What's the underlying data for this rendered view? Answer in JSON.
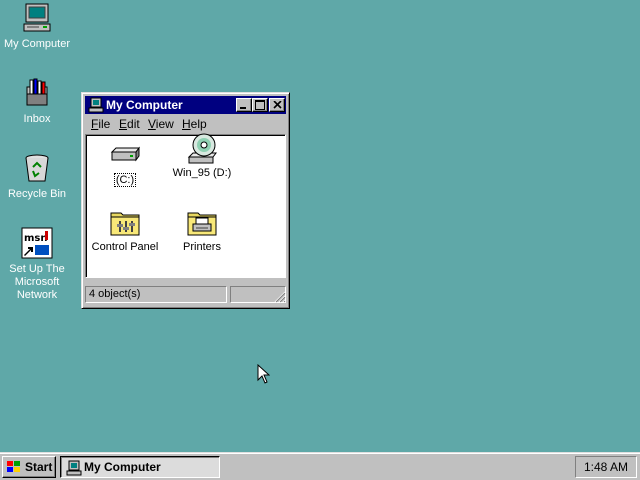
{
  "desktop": {
    "background": "#5fa8a8",
    "icons": [
      {
        "label": "My Computer",
        "icon": "my-computer-icon"
      },
      {
        "label": "Inbox",
        "icon": "inbox-icon"
      },
      {
        "label": "Recycle Bin",
        "icon": "recycle-bin-icon"
      },
      {
        "label": "Set Up The Microsoft Network",
        "icon": "msn-icon"
      }
    ]
  },
  "window": {
    "title": "My Computer",
    "menu": [
      "File",
      "Edit",
      "View",
      "Help"
    ],
    "items": [
      {
        "label": "(C:)",
        "icon": "hard-drive-icon"
      },
      {
        "label": "Win_95 (D:)",
        "icon": "cd-drive-icon"
      },
      {
        "label": "Control Panel",
        "icon": "control-panel-folder-icon"
      },
      {
        "label": "Printers",
        "icon": "printers-folder-icon"
      }
    ],
    "status": "4 object(s)",
    "title_color": "#000080"
  },
  "taskbar": {
    "start_label": "Start",
    "task_label": "My Computer",
    "clock": "1:48 AM"
  }
}
